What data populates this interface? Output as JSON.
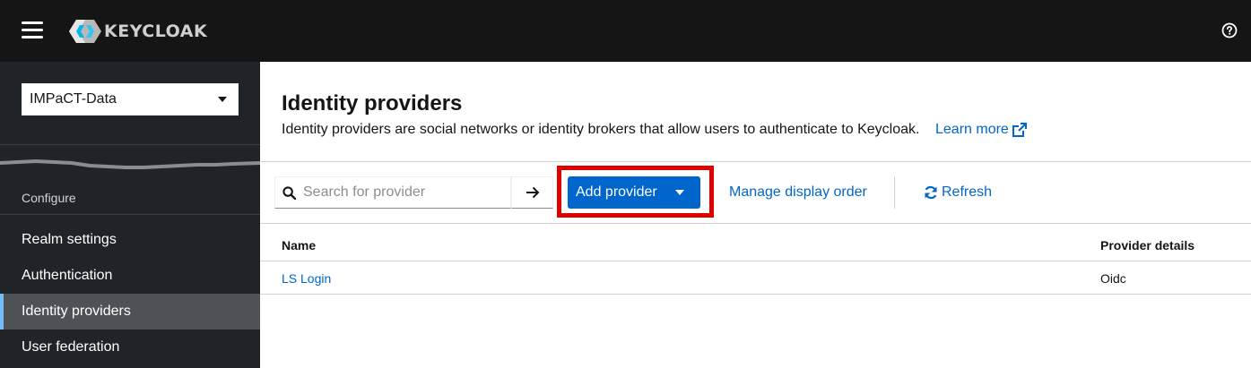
{
  "header": {
    "logo_text": "KEYCLOAK",
    "menu_icon": "hamburger-icon",
    "help_icon": "help-icon"
  },
  "sidebar": {
    "realm": "IMPaCT-Data",
    "section": "Configure",
    "items": [
      {
        "label": "Realm settings",
        "active": false
      },
      {
        "label": "Authentication",
        "active": false
      },
      {
        "label": "Identity providers",
        "active": true
      },
      {
        "label": "User federation",
        "active": false
      }
    ]
  },
  "page": {
    "title": "Identity providers",
    "description": "Identity providers are social networks or identity brokers that allow users to authenticate to Keycloak.",
    "learn_more": "Learn more"
  },
  "toolbar": {
    "search_placeholder": "Search for provider",
    "add_provider": "Add provider",
    "manage_order": "Manage display order",
    "refresh": "Refresh"
  },
  "table": {
    "columns": [
      "Name",
      "Provider details"
    ],
    "rows": [
      {
        "name": "LS Login",
        "details": "Oidc"
      }
    ]
  },
  "colors": {
    "masthead": "#151515",
    "sidebar": "#212427",
    "link": "#0066cc",
    "primary": "#0066cc",
    "highlight": "#e00000",
    "active_accent": "#73bcf7"
  }
}
